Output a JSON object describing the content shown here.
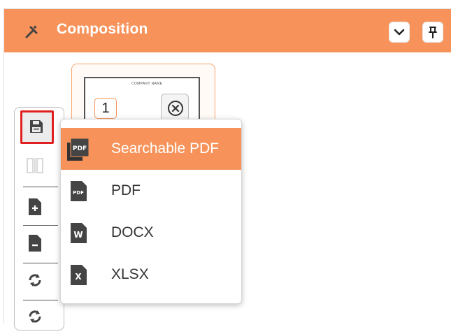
{
  "panel": {
    "title": "Composition",
    "header_color": "#f7935a",
    "icons": [
      "wand-icon",
      "chevron-down-icon",
      "pin-icon"
    ]
  },
  "thumbnail": {
    "company_text": "COMPANY NAME",
    "page_number": "1",
    "remove_icon": "circle-x-icon"
  },
  "toolbar": {
    "tools": [
      "save-icon",
      "split-icon",
      "add-page-icon",
      "remove-page-icon",
      "rotate-icon",
      "refresh-icon"
    ]
  },
  "export_menu": {
    "items": [
      {
        "label": "Searchable PDF",
        "icon": "searchable-pdf-icon",
        "icon_text": "PDF",
        "active": true
      },
      {
        "label": "PDF",
        "icon": "pdf-icon",
        "icon_text": "PDF",
        "active": false
      },
      {
        "label": "DOCX",
        "icon": "docx-icon",
        "icon_text": "W",
        "active": false
      },
      {
        "label": "XLSX",
        "icon": "xlsx-icon",
        "icon_text": "X",
        "active": false
      }
    ]
  }
}
